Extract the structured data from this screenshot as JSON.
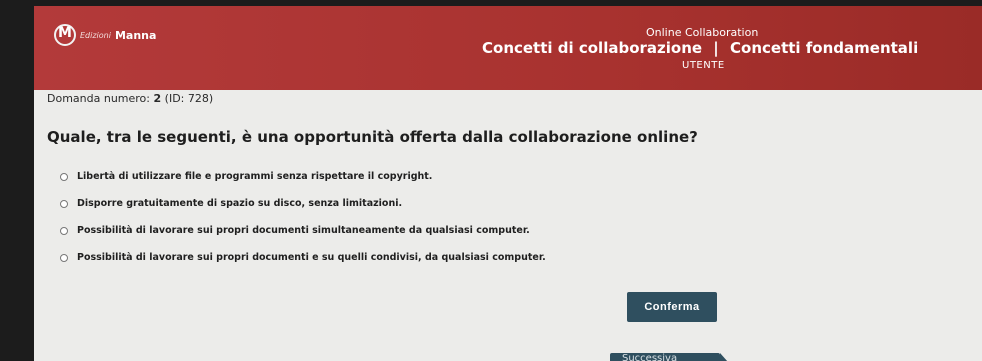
{
  "header": {
    "logo_small": "Edizioni",
    "logo_name": "Manna",
    "course": "Online Collaboration",
    "title": "Concetti di collaborazione",
    "separator": "|",
    "subtitle": "Concetti fondamentali",
    "role": "UTENTE"
  },
  "question": {
    "number_label": "Domanda numero:",
    "number": "2",
    "id_label": "(ID: 728)",
    "text": "Quale, tra le seguenti, è una opportunità offerta dalla collaborazione online?"
  },
  "options": [
    "Libertà di utilizzare file e programmi senza rispettare il copyright.",
    "Disporre gratuitamente di spazio su disco, senza limitazioni.",
    "Possibilità di lavorare sui propri documenti simultaneamente da qualsiasi computer.",
    "Possibilità di lavorare sui propri documenti e su quelli condivisi, da qualsiasi computer."
  ],
  "buttons": {
    "confirm": "Conferma",
    "next": "Successiva"
  },
  "colors": {
    "header": "#b33a3a",
    "button": "#2f4f5f"
  }
}
